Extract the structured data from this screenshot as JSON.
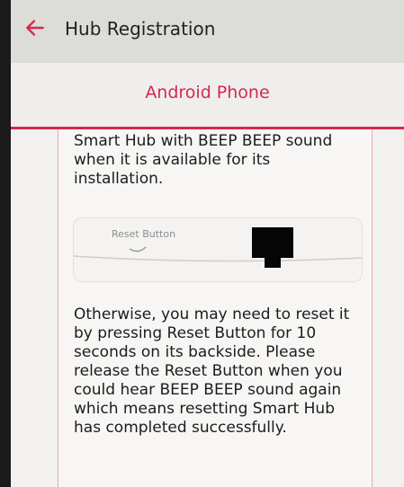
{
  "appbar": {
    "title": "Hub Registration",
    "back_icon": "arrow-left-icon",
    "accent_color": "#d6274f"
  },
  "subheader": {
    "title": "Android Phone"
  },
  "content": {
    "paragraph_1": "Smart Hub with BEEP BEEP sound when it is available for its installation.",
    "illustration": {
      "label": "Reset Button"
    },
    "paragraph_2": "Otherwise, you may need to reset it by pressing Reset Button for 10 seconds on its backside. Please release the Reset Button when you could hear BEEP BEEP sound again which means resetting Smart Hub has completed successfully."
  }
}
